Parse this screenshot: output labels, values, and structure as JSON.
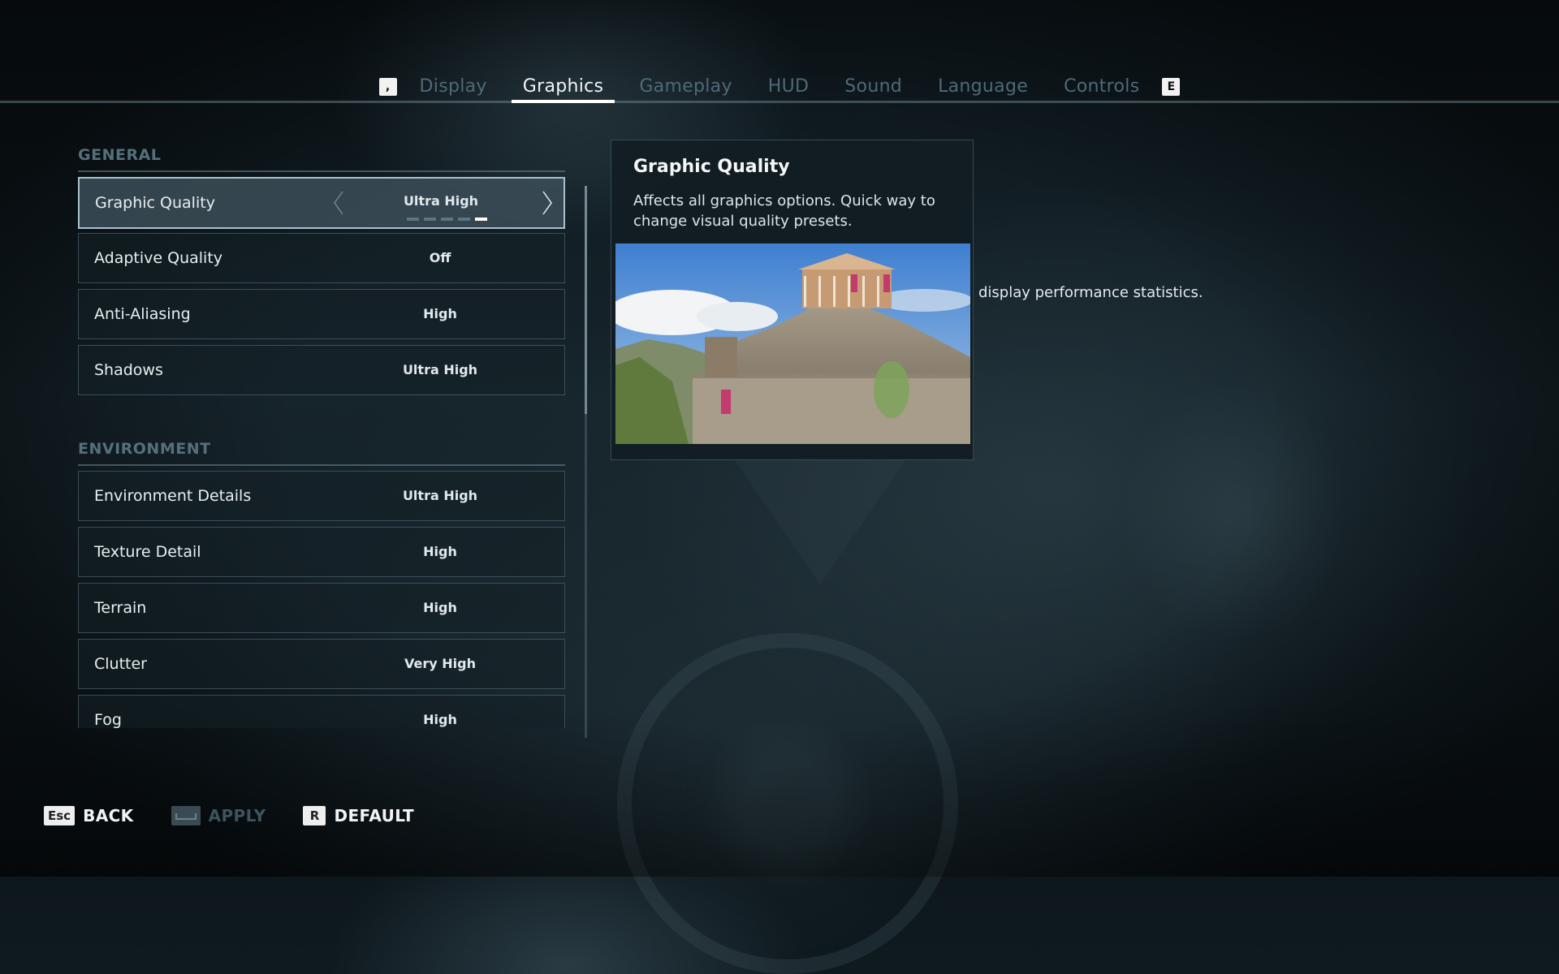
{
  "tabs": {
    "prev_key": ",",
    "next_key": "E",
    "items": [
      {
        "label": "Display",
        "active": false
      },
      {
        "label": "Graphics",
        "active": true
      },
      {
        "label": "Gameplay",
        "active": false
      },
      {
        "label": "HUD",
        "active": false
      },
      {
        "label": "Sound",
        "active": false
      },
      {
        "label": "Language",
        "active": false
      },
      {
        "label": "Controls",
        "active": false
      }
    ]
  },
  "sections": {
    "general": {
      "title": "GENERAL",
      "rows": [
        {
          "label": "Graphic Quality",
          "value": "Ultra High",
          "selected": true,
          "slider_positions": 5,
          "slider_index": 5
        },
        {
          "label": "Adaptive Quality",
          "value": "Off"
        },
        {
          "label": "Anti-Aliasing",
          "value": "High"
        },
        {
          "label": "Shadows",
          "value": "Ultra High"
        }
      ]
    },
    "environment": {
      "title": "ENVIRONMENT",
      "rows": [
        {
          "label": "Environment Details",
          "value": "Ultra High"
        },
        {
          "label": "Texture Detail",
          "value": "High"
        },
        {
          "label": "Terrain",
          "value": "High"
        },
        {
          "label": "Clutter",
          "value": "Very High"
        },
        {
          "label": "Fog",
          "value": "High"
        }
      ]
    }
  },
  "description": {
    "title": "Graphic Quality",
    "text": "Affects all graphics options. Quick way to change visual quality presets.",
    "image_alt": "Preview of a hilltop temple fortress",
    "stray_text": "display performance statistics."
  },
  "scrollbar": {
    "position_fraction": 0.0,
    "visible_fraction": 0.41
  },
  "footer": {
    "back": {
      "key": "Esc",
      "label": "BACK"
    },
    "apply": {
      "key": "space",
      "label": "APPLY",
      "enabled": false
    },
    "default": {
      "key": "R",
      "label": "DEFAULT"
    }
  }
}
